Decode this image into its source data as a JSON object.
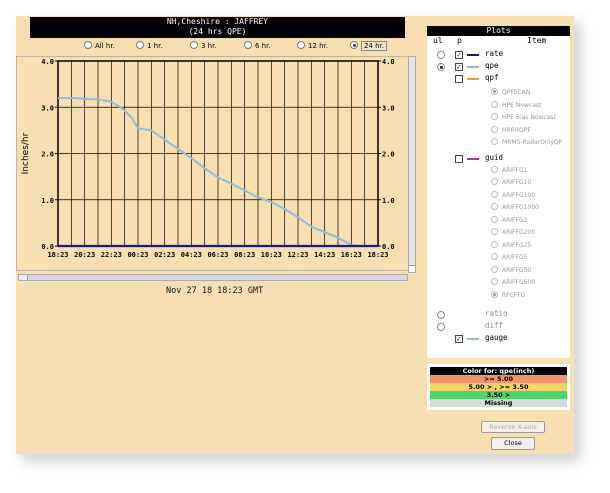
{
  "window": {
    "title_line1": "NH,Cheshire : JAFFREY",
    "title_line2": "(24 hrs QPE)"
  },
  "time_options": [
    {
      "label": "All hr.",
      "selected": false
    },
    {
      "label": "1 hr.",
      "selected": false
    },
    {
      "label": "3 hr.",
      "selected": false
    },
    {
      "label": "6 hr.",
      "selected": false
    },
    {
      "label": "12 hr.",
      "selected": false
    },
    {
      "label": "24 hr.",
      "selected": true
    }
  ],
  "chart_data": {
    "type": "line",
    "ylabel": "Inches/hr",
    "ylim": [
      0,
      4
    ],
    "yticks": [
      "4.0",
      "3.0",
      "2.0",
      "1.0",
      "0.0"
    ],
    "xticks": [
      "18:23",
      "20:23",
      "22:23",
      "00:23",
      "02:23",
      "04:23",
      "06:23",
      "08:23",
      "10:23",
      "12:23",
      "14:23",
      "16:23",
      "18:23"
    ],
    "x_hours": [
      0,
      2,
      4,
      6,
      8,
      10,
      12,
      14,
      16,
      18,
      20,
      22,
      24
    ],
    "grid": true,
    "series": [
      {
        "color": "#8fbcd8",
        "x": [
          0,
          1.2,
          2,
          3,
          4,
          4.8,
          5.5,
          6,
          7,
          8,
          9,
          10,
          11,
          12,
          13,
          14,
          15,
          16,
          17,
          18,
          19,
          20,
          21,
          22,
          22.5,
          23,
          24
        ],
        "y": [
          3.2,
          3.2,
          3.18,
          3.17,
          3.12,
          2.98,
          2.78,
          2.55,
          2.5,
          2.3,
          2.1,
          1.9,
          1.68,
          1.48,
          1.35,
          1.2,
          1.05,
          0.95,
          0.8,
          0.62,
          0.42,
          0.3,
          0.18,
          0.02,
          0,
          0,
          0
        ]
      },
      {
        "color": "#1a1a8c",
        "x": [
          0,
          24
        ],
        "y": [
          0,
          0
        ]
      }
    ]
  },
  "date_label": "Nov 27 18 18:23 GMT",
  "plots_panel": {
    "title": "Plots",
    "col_ul": "ul",
    "col_p": "p",
    "col_item": "Item",
    "rows": [
      {
        "label": "rate",
        "radio": false,
        "check": true,
        "color": "#1a1a8c",
        "dim": false
      },
      {
        "label": "qpe",
        "radio": true,
        "check": true,
        "color": "#8fbcd8",
        "dim": false
      },
      {
        "label": "qpf",
        "radio": null,
        "check": false,
        "color": "#e0a040",
        "dim": false
      }
    ],
    "qpf_items": [
      {
        "label": "QPFSCAN",
        "on": true
      },
      {
        "label": "HPE Nowcast",
        "on": false
      },
      {
        "label": "HPE Bias Nowcast",
        "on": false
      },
      {
        "label": "HRRRQPF",
        "on": false
      },
      {
        "label": "MRMS-RadarOnlyQP",
        "on": false
      }
    ],
    "guid_row": {
      "label": "guid",
      "color": "#9b30c8"
    },
    "guid_items": [
      {
        "label": "ARIFFG1",
        "on": false
      },
      {
        "label": "ARIFFG10",
        "on": false
      },
      {
        "label": "ARIFFG100",
        "on": false
      },
      {
        "label": "ARIFFG1000",
        "on": false
      },
      {
        "label": "ARIFFG2",
        "on": false
      },
      {
        "label": "ARIFFG200",
        "on": false
      },
      {
        "label": "ARIFFG25",
        "on": false
      },
      {
        "label": "ARIFFG5",
        "on": false
      },
      {
        "label": "ARIFFG50",
        "on": false
      },
      {
        "label": "ARIFFG500",
        "on": false
      },
      {
        "label": "RFCFFG",
        "on": true
      }
    ],
    "ratio_label": "ratio",
    "diff_label": "diff",
    "gauge_label": "gauge",
    "gauge_color": "#8fbcd8"
  },
  "color_legend": {
    "title": "Color for: qpe(inch)",
    "rows": [
      {
        "text": ">= 5.00",
        "color": "#f2936f"
      },
      {
        "text": "5.00 > , >= 3.50",
        "color": "#f5d46a"
      },
      {
        "text": "3.50 >",
        "color": "#4ed46a"
      },
      {
        "text": "Missing",
        "color": "#d8d8d8"
      }
    ]
  },
  "buttons": {
    "reverse": "Reverse X-axis",
    "close": "Close"
  }
}
